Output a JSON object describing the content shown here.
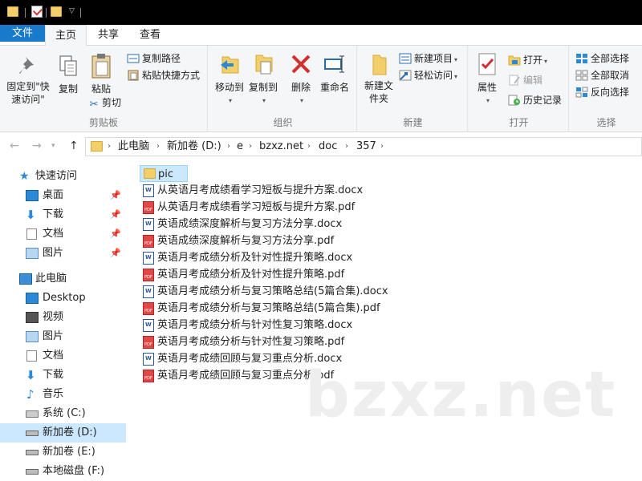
{
  "tabs": {
    "file": "文件",
    "home": "主页",
    "share": "共享",
    "view": "查看"
  },
  "ribbon": {
    "clipboard": {
      "label": "剪贴板",
      "pin_quick": "固定到\"快速访问\"",
      "copy": "复制",
      "paste": "粘贴",
      "copy_path": "复制路径",
      "paste_shortcut": "粘贴快捷方式",
      "cut": "剪切"
    },
    "organize": {
      "label": "组织",
      "move_to": "移动到",
      "copy_to": "复制到",
      "delete": "删除",
      "rename": "重命名"
    },
    "new": {
      "label": "新建",
      "new_folder": "新建文件夹",
      "new_item": "新建项目",
      "easy_access": "轻松访问"
    },
    "open": {
      "label": "打开",
      "properties": "属性",
      "open": "打开",
      "edit": "编辑",
      "history": "历史记录"
    },
    "select": {
      "label": "选择",
      "select_all": "全部选择",
      "select_none": "全部取消",
      "invert": "反向选择"
    }
  },
  "breadcrumb": [
    "此电脑",
    "新加卷 (D:)",
    "e",
    "bzxz.net",
    "doc",
    "357"
  ],
  "sidebar": {
    "quick_access": "快速访问",
    "quick_items": [
      "桌面",
      "下载",
      "文档",
      "图片"
    ],
    "this_pc": "此电脑",
    "pc_items": [
      "Desktop",
      "视频",
      "图片",
      "文档",
      "下载",
      "音乐"
    ],
    "drives": [
      "系统 (C:)",
      "新加卷 (D:)",
      "新加卷 (E:)",
      "本地磁盘 (F:)"
    ]
  },
  "files": [
    {
      "name": "pic",
      "type": "folder"
    },
    {
      "name": "从英语月考成绩看学习短板与提升方案.docx",
      "type": "docx"
    },
    {
      "name": "从英语月考成绩看学习短板与提升方案.pdf",
      "type": "pdf"
    },
    {
      "name": "英语成绩深度解析与复习方法分享.docx",
      "type": "docx"
    },
    {
      "name": "英语成绩深度解析与复习方法分享.pdf",
      "type": "pdf"
    },
    {
      "name": "英语月考成绩分析及针对性提升策略.docx",
      "type": "docx"
    },
    {
      "name": "英语月考成绩分析及针对性提升策略.pdf",
      "type": "pdf"
    },
    {
      "name": "英语月考成绩分析与复习策略总结(5篇合集).docx",
      "type": "docx"
    },
    {
      "name": "英语月考成绩分析与复习策略总结(5篇合集).pdf",
      "type": "pdf"
    },
    {
      "name": "英语月考成绩分析与针对性复习策略.docx",
      "type": "docx"
    },
    {
      "name": "英语月考成绩分析与针对性复习策略.pdf",
      "type": "pdf"
    },
    {
      "name": "英语月考成绩回顾与复习重点分析.docx",
      "type": "docx"
    },
    {
      "name": "英语月考成绩回顾与复习重点分析.pdf",
      "type": "pdf"
    }
  ],
  "watermark": "bzxz.net",
  "colors": {
    "accent": "#1979ca",
    "selection": "#cce8ff",
    "folder": "#f2cf6b",
    "pdf": "#e04848",
    "word": "#2b579a"
  }
}
